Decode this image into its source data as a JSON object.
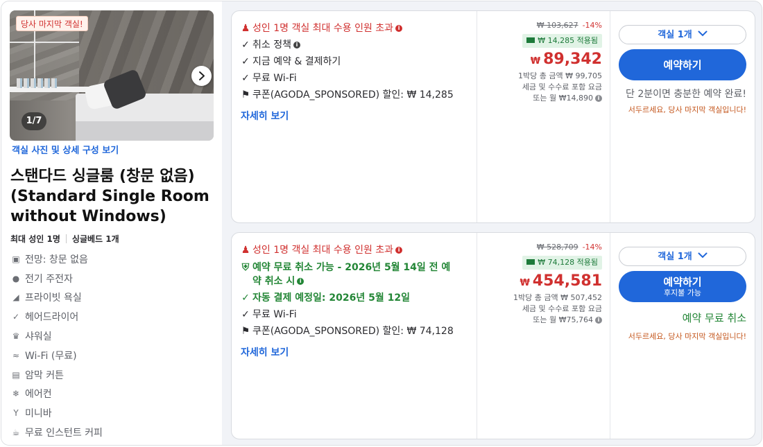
{
  "room": {
    "photo_badge": "당사 마지막 객실!",
    "photo_counter": "1/7",
    "photo_link": "객실 사진 및 상세 구성 보기",
    "title": "스탠다드 싱글룸 (창문 없음) (Standard Single Room without Windows)",
    "max_adults": "최대 성인 1명",
    "bed": "싱글베드 1개",
    "amenities": [
      {
        "icon": "view-icon",
        "label": "전망: 창문 없음"
      },
      {
        "icon": "ev-charger-icon",
        "label": "전기 주전자"
      },
      {
        "icon": "shower-icon",
        "label": "프라이빗 욕실"
      },
      {
        "icon": "check-icon",
        "label": "헤어드라이어"
      },
      {
        "icon": "shower-head-icon",
        "label": "샤워실"
      },
      {
        "icon": "wifi-icon",
        "label": "Wi-Fi (무료)"
      },
      {
        "icon": "curtain-icon",
        "label": "암막 커튼"
      },
      {
        "icon": "snowflake-icon",
        "label": "에어컨"
      },
      {
        "icon": "cocktail-icon",
        "label": "미니바"
      },
      {
        "icon": "coffee-icon",
        "label": "무료 인스턴트 커피"
      }
    ]
  },
  "offers": [
    {
      "occupancy_warning": "성인 1명 객실 최대 수용 인원 초과",
      "features": [
        {
          "icon": "check-icon",
          "text": "취소 정책",
          "style": "plain",
          "info": true
        },
        {
          "icon": "check-icon",
          "text": "지금 예약 & 결제하기",
          "style": "plain",
          "info": false
        },
        {
          "icon": "check-icon",
          "text": "무료 Wi-Fi",
          "style": "plain",
          "info": false
        }
      ],
      "coupon": "쿠폰(AGODA_SPONSORED) 할인: ₩ 14,285",
      "details_link": "자세히 보기",
      "old_price": "₩ 103,627",
      "discount": "-14%",
      "coupon_applied": "₩ 14,285 적용됨",
      "currency": "₩",
      "price": "89,342",
      "total_per_night": "1박당 총 금액 ₩ 99,705",
      "tax_note": "세금 및 수수료 포함 요금",
      "monthly": "또는 월 ₩14,890",
      "room_select": "객실 1개",
      "book_label": "예약하기",
      "book_sub": "",
      "urgency": "단 2분이면 충분한 예약 완료!",
      "urgency_style": "gray",
      "last_room": "서두르세요, 당사 마지막 객실입니다!"
    },
    {
      "occupancy_warning": "성인 1명 객실 최대 수용 인원 초과",
      "features": [
        {
          "icon": "shield-check-icon",
          "text": "예약 무료 취소 가능 - 2026년 5월 14일 전 예약 취소 시",
          "style": "green",
          "info": true
        },
        {
          "icon": "check-icon",
          "text": "자동 결제 예정일: 2026년 5월 12일",
          "style": "green",
          "info": false
        },
        {
          "icon": "check-icon",
          "text": "무료 Wi-Fi",
          "style": "plain",
          "info": false
        }
      ],
      "coupon": "쿠폰(AGODA_SPONSORED) 할인: ₩ 74,128",
      "details_link": "자세히 보기",
      "old_price": "₩ 528,709",
      "discount": "-14%",
      "coupon_applied": "₩ 74,128 적용됨",
      "currency": "₩",
      "price": "454,581",
      "total_per_night": "1박당 총 금액 ₩ 507,452",
      "tax_note": "세금 및 수수료 포함 요금",
      "monthly": "또는 월 ₩75,764",
      "room_select": "객실 1개",
      "book_label": "예약하기",
      "book_sub": "후지불 가능",
      "urgency": "예약 무료 취소",
      "urgency_style": "green",
      "last_room": "서두르세요, 당사 마지막 객실입니다!"
    }
  ],
  "colors": {
    "accent_blue": "#2067da",
    "price_red": "#d0302f",
    "success_green": "#238636",
    "urgency_orange": "#c4561c"
  }
}
